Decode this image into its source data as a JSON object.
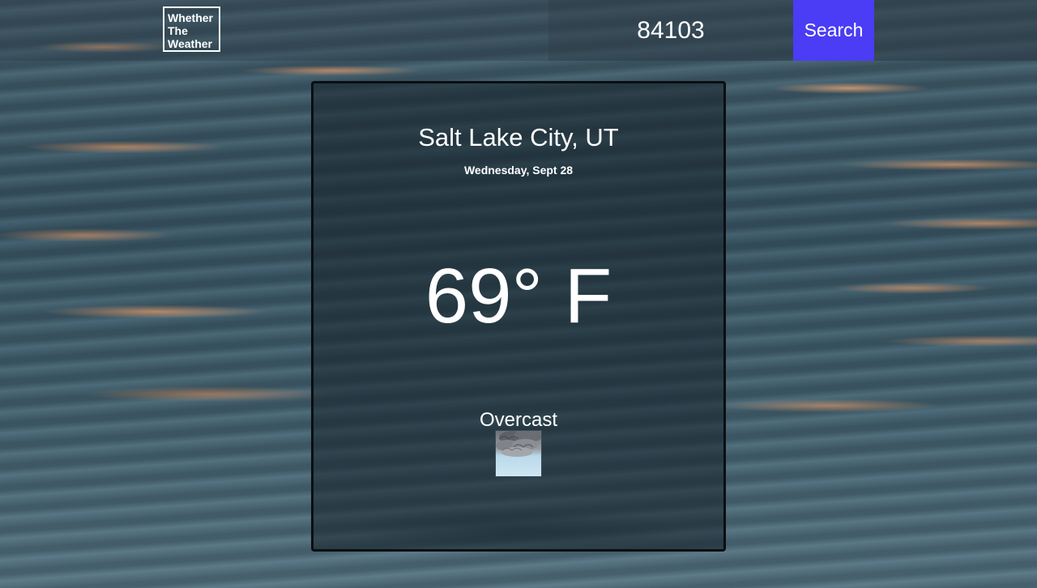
{
  "header": {
    "logo_lines": [
      "Whether",
      "The",
      "Weather"
    ],
    "zip_value": "84103",
    "search_label": "Search"
  },
  "weather": {
    "city": "Salt Lake City, UT",
    "date": "Wednesday, Sept 28",
    "temperature": "69° F",
    "condition": "Overcast",
    "icon": "cloud-icon"
  },
  "colors": {
    "search_button": "#4b3cf5",
    "text": "#ffffff",
    "card_border": "#0a0f12"
  }
}
